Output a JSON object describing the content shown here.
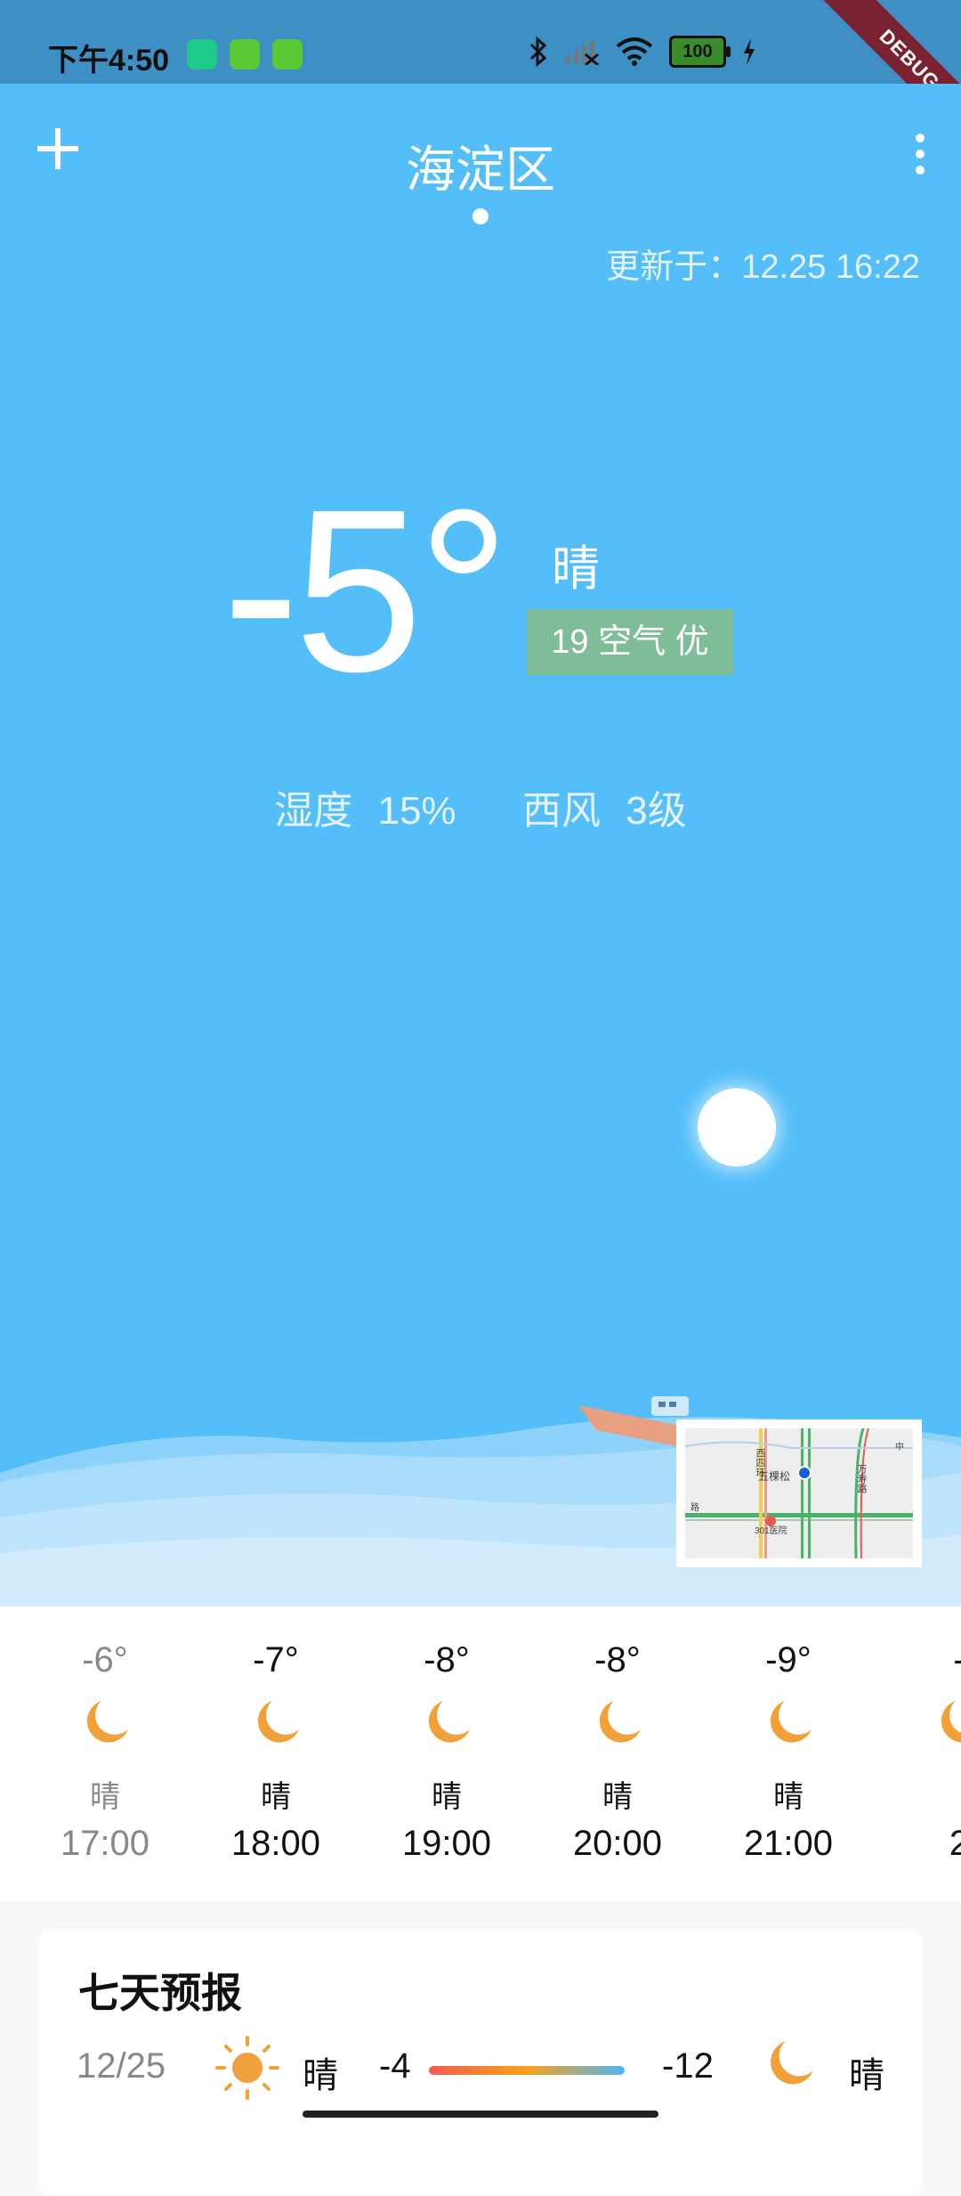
{
  "status_bar": {
    "time": "下午4:50",
    "battery": "100",
    "debug_banner": "DEBUG",
    "icons": [
      "shield-app-icon",
      "cat-app-icon",
      "cat-app-icon",
      "bluetooth-icon",
      "cellular-off-icon",
      "wifi-icon",
      "battery-icon",
      "charging-icon"
    ]
  },
  "header": {
    "city": "海淀区",
    "updated": "更新于：12.25 16:22"
  },
  "current": {
    "temperature": "-5°",
    "condition": "晴",
    "aqi_badge": "19 空气 优",
    "humidity_label": "湿度",
    "humidity_value": "15%",
    "wind_dir": "西风",
    "wind_level": "3级"
  },
  "map_labels": {
    "road_west": "西四环",
    "road_east": "万寿路",
    "place": "五棵松",
    "hospital": "301医院",
    "road_bottom": "路",
    "corner": "中"
  },
  "hourly": [
    {
      "temp": "-6°",
      "cond": "晴",
      "time": "17:00"
    },
    {
      "temp": "-7°",
      "cond": "晴",
      "time": "18:00"
    },
    {
      "temp": "-8°",
      "cond": "晴",
      "time": "19:00"
    },
    {
      "temp": "-8°",
      "cond": "晴",
      "time": "20:00"
    },
    {
      "temp": "-9°",
      "cond": "晴",
      "time": "21:00"
    },
    {
      "temp": "-",
      "cond": "",
      "time": "2"
    }
  ],
  "forecast": {
    "title": "七天预报",
    "days": [
      {
        "date": "12/25",
        "day_cond": "晴",
        "high": "-4",
        "low": "-12",
        "night_cond": "晴"
      }
    ]
  },
  "colors": {
    "sky": "#53bef8",
    "status_bar": "#3e8fc4",
    "aqi_good": "#7fbd99",
    "icon_orange": "#f0a13a"
  }
}
